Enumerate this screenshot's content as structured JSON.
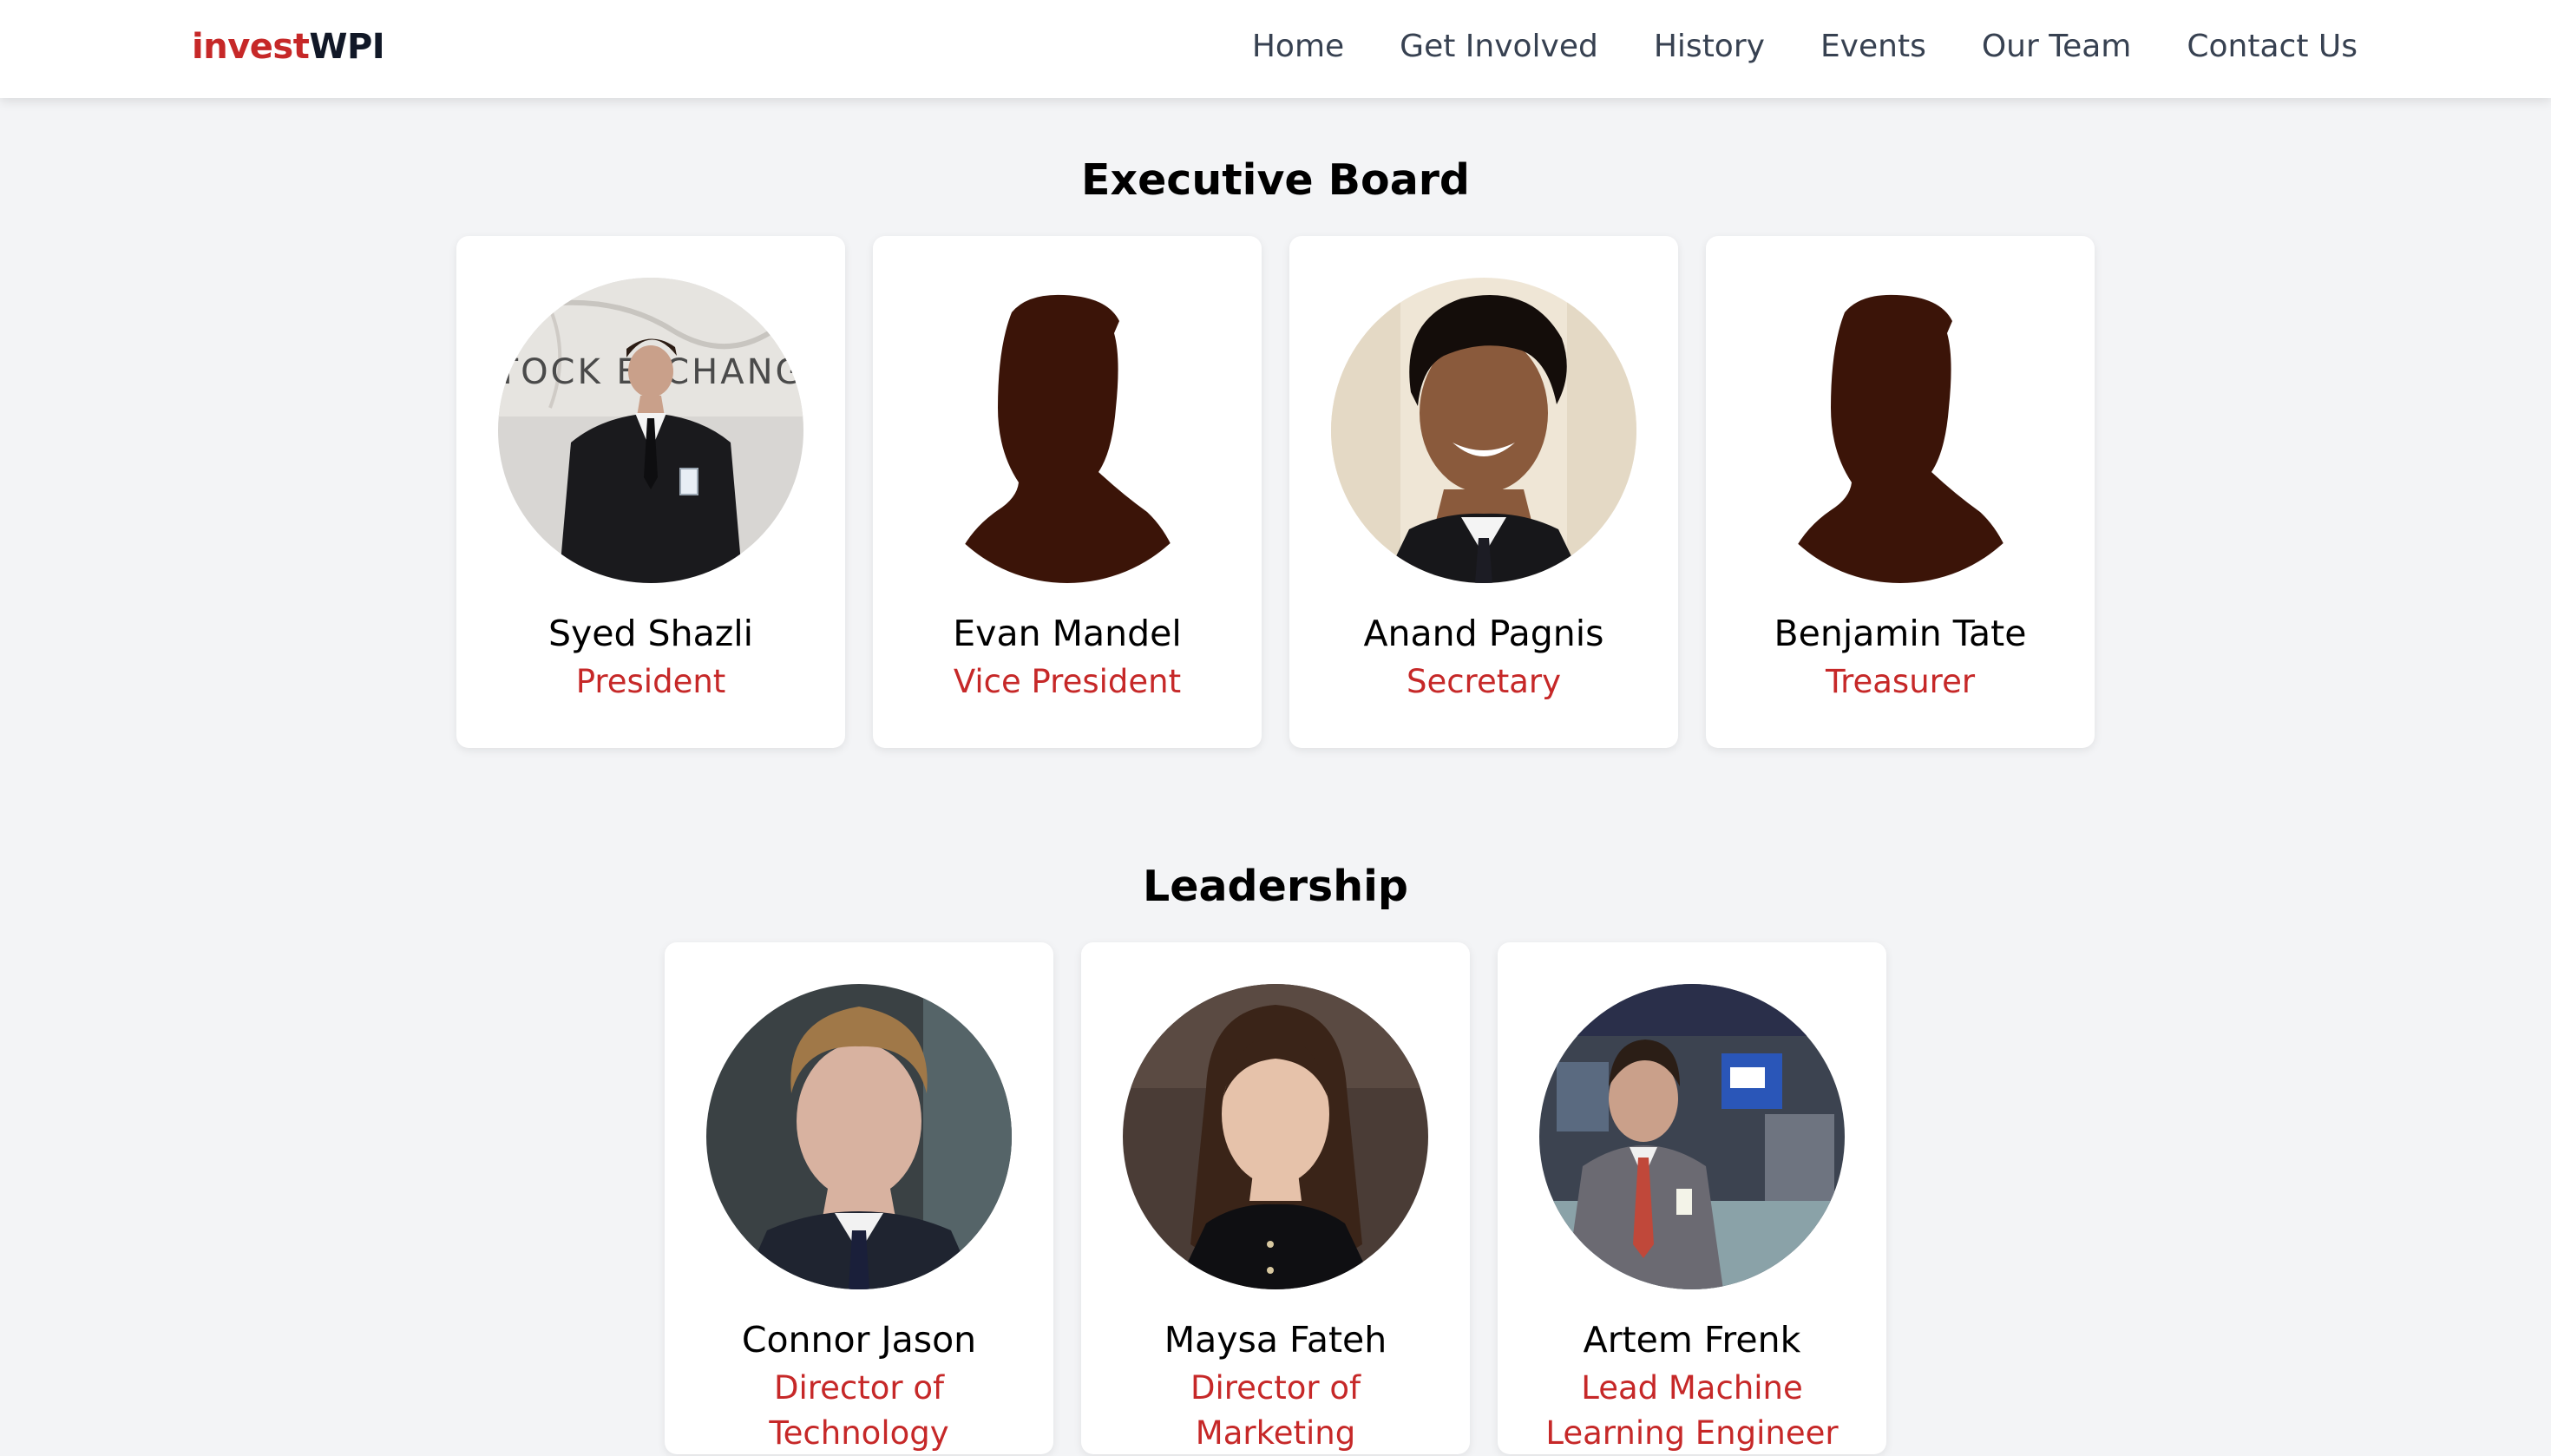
{
  "brand": {
    "part1": "invest",
    "part2": "WPI"
  },
  "nav": {
    "items": [
      {
        "label": "Home"
      },
      {
        "label": "Get Involved"
      },
      {
        "label": "History"
      },
      {
        "label": "Events"
      },
      {
        "label": "Our Team"
      },
      {
        "label": "Contact Us"
      }
    ]
  },
  "executive": {
    "title": "Executive Board",
    "members": [
      {
        "name": "Syed Shazli",
        "role": "President",
        "photo": "photo"
      },
      {
        "name": "Evan Mandel",
        "role": "Vice President",
        "photo": "silhouette"
      },
      {
        "name": "Anand Pagnis",
        "role": "Secretary",
        "photo": "photo"
      },
      {
        "name": "Benjamin Tate",
        "role": "Treasurer",
        "photo": "silhouette"
      }
    ]
  },
  "leadership": {
    "title": "Leadership",
    "members": [
      {
        "name": "Connor Jason",
        "role": "Director of Technology",
        "photo": "photo"
      },
      {
        "name": "Maysa Fateh",
        "role": "Director of Marketing",
        "photo": "photo"
      },
      {
        "name": "Artem Frenk",
        "role": "Lead Machine Learning Engineer",
        "photo": "photo"
      }
    ]
  },
  "photo_text": {
    "exchange_sign": "STOCK EXCHANGE"
  },
  "colors": {
    "accent": "#c62828",
    "brand_dark": "#111827",
    "nav_text": "#374151",
    "page_bg": "#f3f4f6",
    "card_bg": "#ffffff",
    "silhouette": "#3b1408"
  }
}
